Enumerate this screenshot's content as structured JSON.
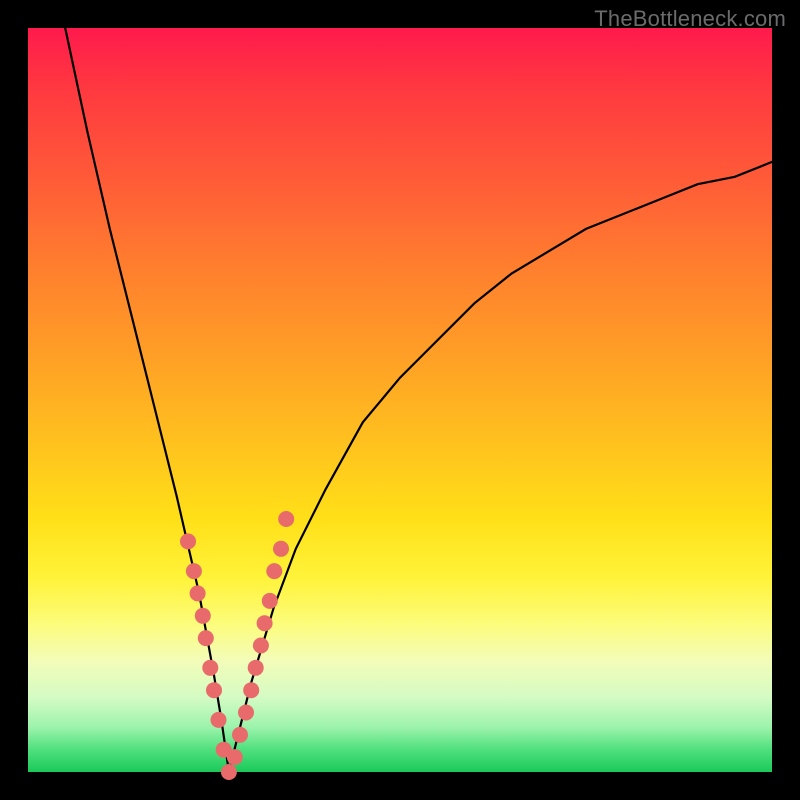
{
  "watermark": "TheBottleneck.com",
  "colors": {
    "dot": "#e86a6a",
    "curve": "#000000",
    "gradient_top": "#ff1a4d",
    "gradient_bottom": "#1bc95a"
  },
  "chart_data": {
    "type": "line",
    "title": "",
    "xlabel": "",
    "ylabel": "",
    "xlim": [
      0,
      100
    ],
    "ylim": [
      0,
      100
    ],
    "grid": false,
    "curve_description": "V-shaped bottleneck curve; value falls from 100 at x≈5 to 0 at x≈27 then rises asymptotically toward ~82 at x=100",
    "series": [
      {
        "name": "bottleneck-curve",
        "x": [
          5,
          8,
          11,
          14,
          17,
          20,
          23,
          25,
          26,
          27,
          28,
          30,
          33,
          36,
          40,
          45,
          50,
          55,
          60,
          65,
          70,
          75,
          80,
          85,
          90,
          95,
          100
        ],
        "y": [
          100,
          86,
          73,
          61,
          49,
          37,
          24,
          13,
          7,
          0,
          4,
          12,
          22,
          30,
          38,
          47,
          53,
          58,
          63,
          67,
          70,
          73,
          75,
          77,
          79,
          80,
          82
        ]
      }
    ],
    "scatter": {
      "name": "highlight-dots",
      "x": [
        21.5,
        22.3,
        22.8,
        23.5,
        23.9,
        24.5,
        25.0,
        25.6,
        26.3,
        27.0,
        27.8,
        28.5,
        29.3,
        30.0,
        30.6,
        31.3,
        31.8,
        32.5,
        33.1,
        34.0,
        34.7
      ],
      "y": [
        31,
        27,
        24,
        21,
        18,
        14,
        11,
        7,
        3,
        0,
        2,
        5,
        8,
        11,
        14,
        17,
        20,
        23,
        27,
        30,
        34
      ],
      "radius": 8
    }
  }
}
